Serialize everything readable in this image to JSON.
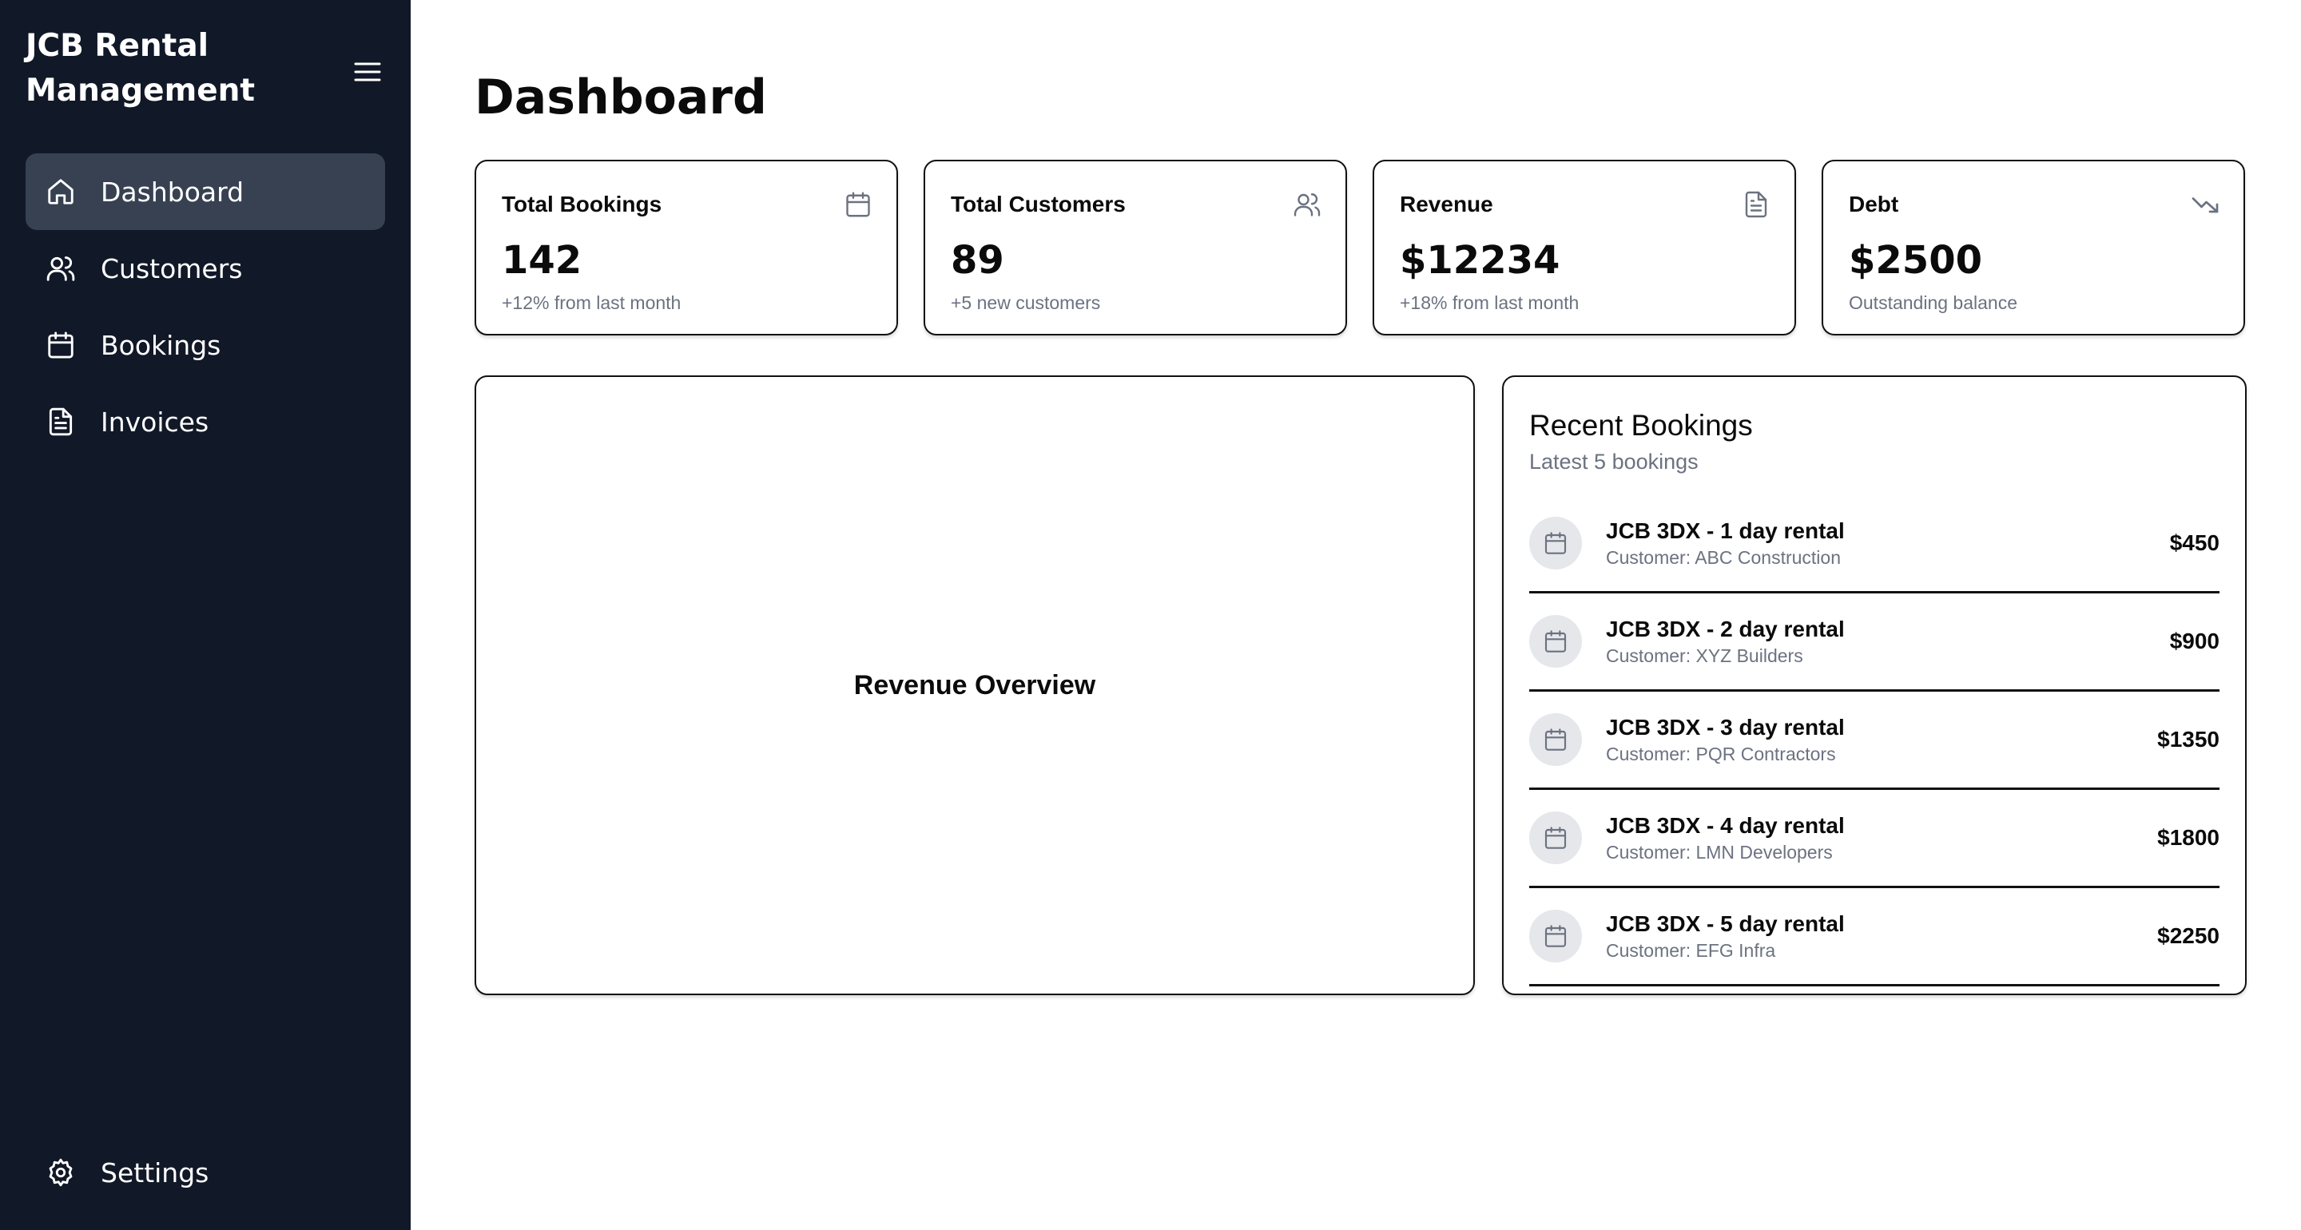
{
  "sidebar": {
    "brand": "JCB Rental Management",
    "items": [
      {
        "label": "Dashboard",
        "icon": "home-icon",
        "active": true
      },
      {
        "label": "Customers",
        "icon": "users-icon",
        "active": false
      },
      {
        "label": "Bookings",
        "icon": "calendar-icon",
        "active": false
      },
      {
        "label": "Invoices",
        "icon": "file-icon",
        "active": false
      }
    ],
    "settings": {
      "label": "Settings",
      "icon": "gear-icon"
    }
  },
  "main": {
    "title": "Dashboard",
    "stats": [
      {
        "label": "Total Bookings",
        "value": "142",
        "sub": "+12% from last month",
        "icon": "calendar-icon"
      },
      {
        "label": "Total Customers",
        "value": "89",
        "sub": "+5 new customers",
        "icon": "users-icon"
      },
      {
        "label": "Revenue",
        "value": "$12234",
        "sub": "+18% from last month",
        "icon": "file-icon"
      },
      {
        "label": "Debt",
        "value": "$2500",
        "sub": "Outstanding balance",
        "icon": "trending-down-icon"
      }
    ],
    "revenue_overview": {
      "title": "Revenue Overview"
    },
    "recent_bookings": {
      "title": "Recent Bookings",
      "subtitle": "Latest 5 bookings",
      "items": [
        {
          "name": "JCB 3DX - 1 day rental",
          "customer": "Customer: ABC Construction",
          "amount": "$450"
        },
        {
          "name": "JCB 3DX - 2 day rental",
          "customer": "Customer: XYZ Builders",
          "amount": "$900"
        },
        {
          "name": "JCB 3DX - 3 day rental",
          "customer": "Customer: PQR Contractors",
          "amount": "$1350"
        },
        {
          "name": "JCB 3DX - 4 day rental",
          "customer": "Customer: LMN Developers",
          "amount": "$1800"
        },
        {
          "name": "JCB 3DX - 5 day rental",
          "customer": "Customer: EFG Infra",
          "amount": "$2250"
        }
      ]
    }
  },
  "colors": {
    "sidebar_bg": "#111827",
    "active_item_bg": "#374151",
    "muted_text": "#6b7280",
    "avatar_bg": "#e5e7eb"
  }
}
